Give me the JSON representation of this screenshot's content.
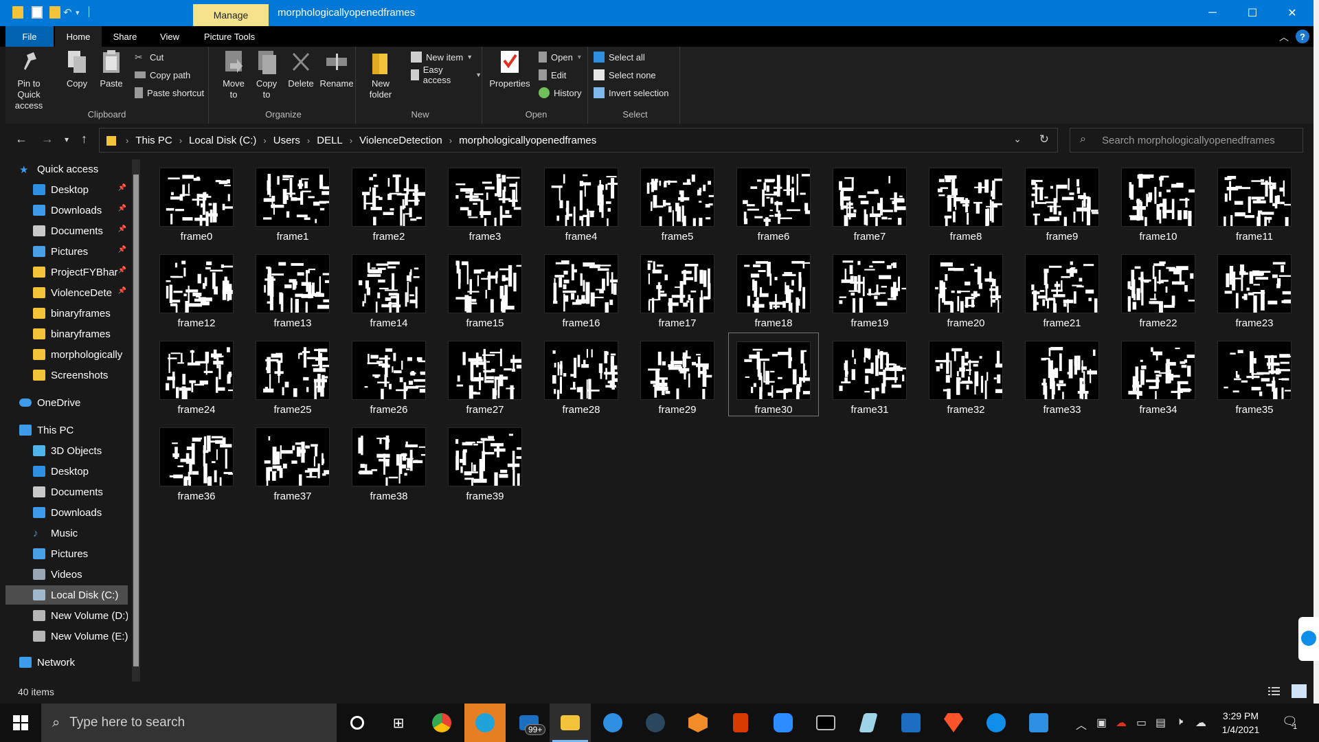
{
  "titlebar": {
    "manage_label": "Manage",
    "window_title": "morphologicallyopenedframes",
    "minimize": "─",
    "maximize": "☐",
    "close": "✕"
  },
  "ribbon_tabs": {
    "file": "File",
    "home": "Home",
    "share": "Share",
    "view": "View",
    "picture_tools": "Picture Tools",
    "help": "?"
  },
  "ribbon": {
    "clipboard": {
      "label": "Clipboard",
      "pin": "Pin to Quick access",
      "copy": "Copy",
      "paste": "Paste",
      "cut": "Cut",
      "copy_path": "Copy path",
      "paste_shortcut": "Paste shortcut"
    },
    "organize": {
      "label": "Organize",
      "move_to": "Move to",
      "copy_to": "Copy to",
      "delete": "Delete",
      "rename": "Rename"
    },
    "new": {
      "label": "New",
      "new_folder": "New folder",
      "new_item": "New item",
      "easy_access": "Easy access"
    },
    "open": {
      "label": "Open",
      "properties": "Properties",
      "open": "Open",
      "edit": "Edit",
      "history": "History"
    },
    "select": {
      "label": "Select",
      "select_all": "Select all",
      "select_none": "Select none",
      "invert_selection": "Invert selection"
    }
  },
  "address": {
    "crumbs": [
      "This PC",
      "Local Disk (C:)",
      "Users",
      "DELL",
      "ViolenceDetection",
      "morphologicallyopenedframes"
    ]
  },
  "search": {
    "placeholder": "Search morphologicallyopenedframes"
  },
  "sidebar": {
    "items": [
      {
        "label": "Quick access",
        "icon": "star-icon",
        "color": "#3d9be9"
      },
      {
        "label": "Desktop",
        "icon": "desktop-icon",
        "color": "#2f8fe0",
        "pinned": true
      },
      {
        "label": "Downloads",
        "icon": "download-icon",
        "color": "#3d9be9",
        "pinned": true
      },
      {
        "label": "Documents",
        "icon": "document-icon",
        "color": "#c9c9c9",
        "pinned": true
      },
      {
        "label": "Pictures",
        "icon": "pictures-icon",
        "color": "#4aa0e6",
        "pinned": true
      },
      {
        "label": "ProjectFYBhar",
        "icon": "folder-icon",
        "color": "#f3c33a",
        "pinned": true
      },
      {
        "label": "ViolenceDete",
        "icon": "folder-icon",
        "color": "#f3c33a",
        "pinned": true
      },
      {
        "label": "binaryframes",
        "icon": "folder-icon",
        "color": "#f3c33a"
      },
      {
        "label": "binaryframes",
        "icon": "folder-icon",
        "color": "#f3c33a"
      },
      {
        "label": "morphologically",
        "icon": "folder-icon",
        "color": "#f3c33a"
      },
      {
        "label": "Screenshots",
        "icon": "folder-icon",
        "color": "#f3c33a"
      },
      {
        "label": "OneDrive",
        "icon": "cloud-icon",
        "color": "#3d9be9"
      },
      {
        "label": "This PC",
        "icon": "computer-icon",
        "color": "#3d9be9"
      },
      {
        "label": "3D Objects",
        "icon": "cube-icon",
        "color": "#4fb3e8"
      },
      {
        "label": "Desktop",
        "icon": "desktop-icon",
        "color": "#2f8fe0"
      },
      {
        "label": "Documents",
        "icon": "document-icon",
        "color": "#c9c9c9"
      },
      {
        "label": "Downloads",
        "icon": "download-icon",
        "color": "#3d9be9"
      },
      {
        "label": "Music",
        "icon": "music-icon",
        "color": "#3d9be9"
      },
      {
        "label": "Pictures",
        "icon": "pictures-icon",
        "color": "#4aa0e6"
      },
      {
        "label": "Videos",
        "icon": "video-icon",
        "color": "#9aa6b4"
      },
      {
        "label": "Local Disk (C:)",
        "icon": "drive-icon",
        "color": "#9fb8cc",
        "selected": true
      },
      {
        "label": "New Volume (D:)",
        "icon": "drive-icon",
        "color": "#b5b5b5"
      },
      {
        "label": "New Volume (E:)",
        "icon": "drive-icon",
        "color": "#b5b5b5"
      },
      {
        "label": "Network",
        "icon": "network-icon",
        "color": "#3d9be9"
      }
    ]
  },
  "files": [
    "frame0",
    "frame1",
    "frame2",
    "frame3",
    "frame4",
    "frame5",
    "frame6",
    "frame7",
    "frame8",
    "frame9",
    "frame10",
    "frame11",
    "frame12",
    "frame13",
    "frame14",
    "frame15",
    "frame16",
    "frame17",
    "frame18",
    "frame19",
    "frame20",
    "frame21",
    "frame22",
    "frame23",
    "frame24",
    "frame25",
    "frame26",
    "frame27",
    "frame28",
    "frame29",
    "frame30",
    "frame31",
    "frame32",
    "frame33",
    "frame34",
    "frame35",
    "frame36",
    "frame37",
    "frame38",
    "frame39"
  ],
  "selected_file": "frame30",
  "status": {
    "item_count": "40 items"
  },
  "taskbar": {
    "search_text": "Type here to search",
    "badge": "99+",
    "time": "3:29 PM",
    "date": "1/4/2021",
    "notification_count": "1"
  },
  "colors": {
    "accent": "#0078d7",
    "manage_tab": "#f5e38c",
    "folder": "#f3c33a"
  }
}
